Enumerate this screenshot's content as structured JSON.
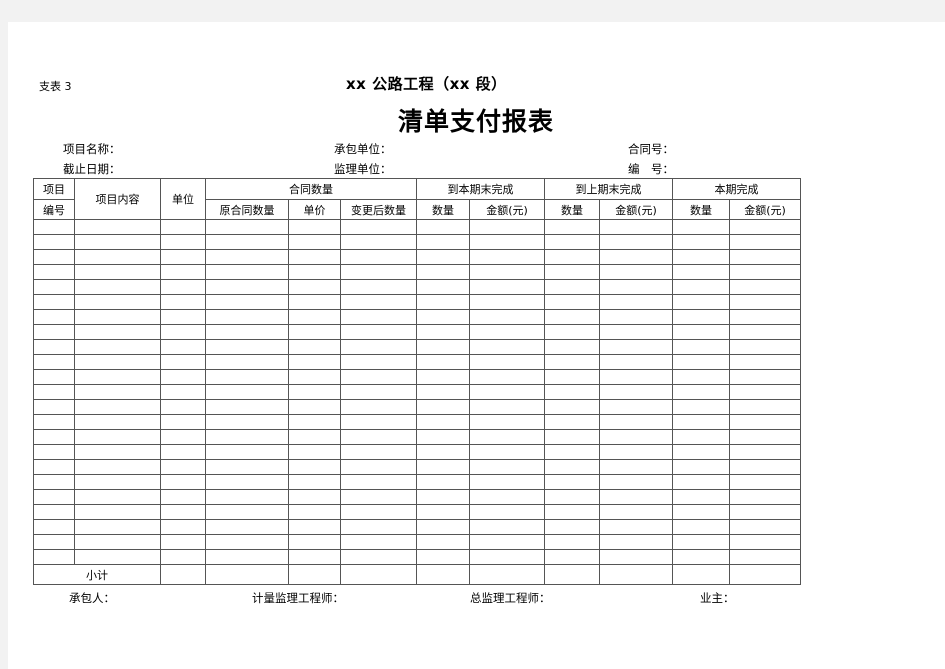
{
  "sheet_label": "支表 3",
  "subtitle": "xx 公路工程（xx 段）",
  "title": "清单支付报表",
  "meta": {
    "project_name": "项目名称：",
    "contractor": "承包单位：",
    "contract_no": "合同号：",
    "cutoff_date": "截止日期：",
    "supervisor": "监理单位：",
    "serial_no": "编　号："
  },
  "table": {
    "headers": {
      "item_no_1": "项目",
      "item_no_2": "编号",
      "item_content": "项目内容",
      "unit": "单位",
      "contract_qty": "合同数量",
      "orig_qty": "原合同数量",
      "unit_price": "单价",
      "changed_qty": "变更后数量",
      "to_current": "到本期末完成",
      "to_previous": "到上期末完成",
      "current": "本期完成",
      "qty": "数量",
      "amount": "金额(元)"
    },
    "row_count": 23,
    "subtotal_label": "小计"
  },
  "signatures": {
    "contractor": "承包人：",
    "metering_engineer": "计量监理工程师：",
    "chief_engineer": "总监理工程师：",
    "owner": "业主："
  }
}
